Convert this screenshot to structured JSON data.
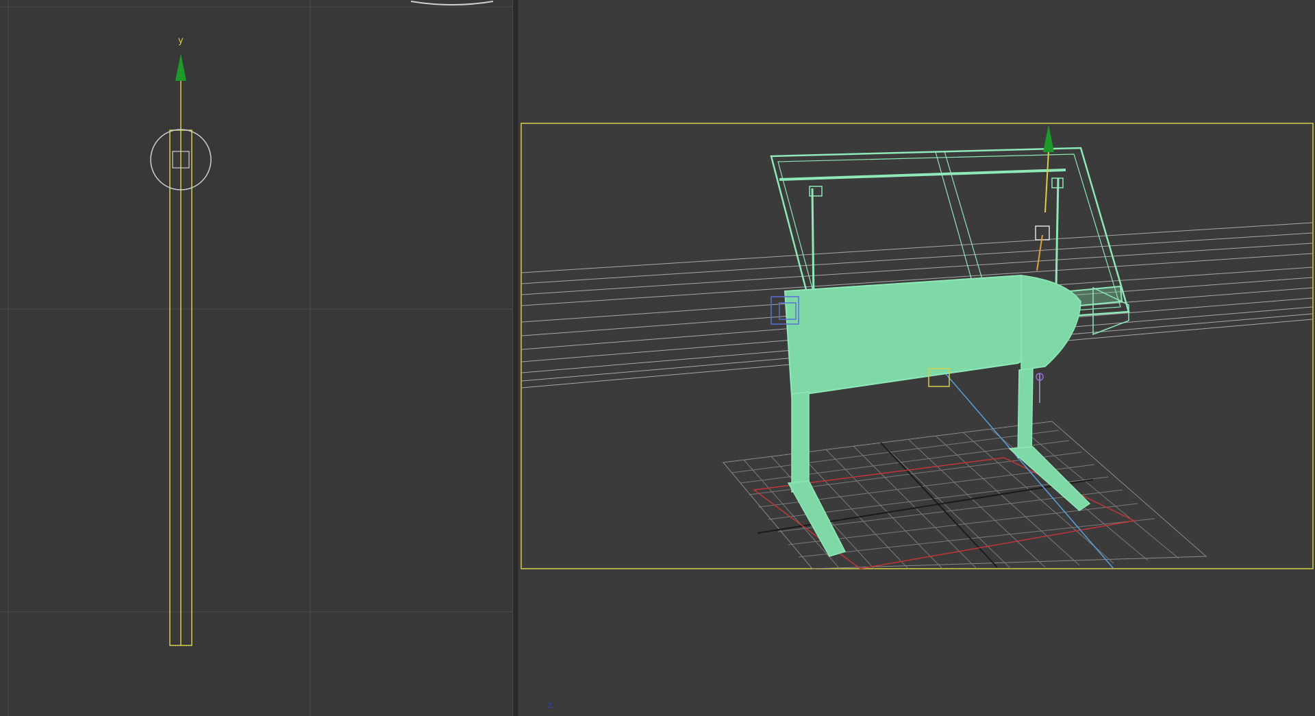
{
  "left_viewport": {
    "axis_label_y": "y"
  },
  "right_viewport": {
    "axis_label_z": "z"
  },
  "colors": {
    "viewport_bg": "#383838",
    "grid_line": "#4d4d4d",
    "selection_yellow": "#d8d04a",
    "gizmo_green": "#1e9a2a",
    "mesh_wire": "#8ee8b8",
    "mesh_fill": "#7fd9a7",
    "floor_grid": "#8a8a8a",
    "grid_red": "#c0363a",
    "light_blue_line": "#5aa0e0"
  }
}
